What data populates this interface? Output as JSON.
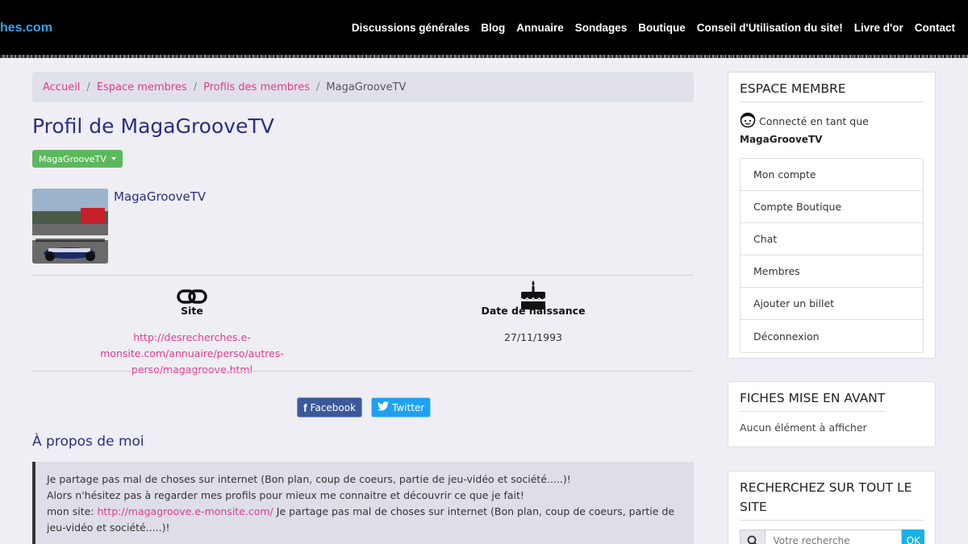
{
  "header": {
    "logo_text": "hes.com",
    "nav": [
      "Discussions générales",
      "Blog",
      "Annuaire",
      "Sondages",
      "Boutique",
      "Conseil d'Utilisation du site!",
      "Livre d'or",
      "Contact"
    ]
  },
  "breadcrumb": {
    "items": [
      "Accueil",
      "Espace membres",
      "Profils des membres"
    ],
    "current": "MagaGrooveTV"
  },
  "profile": {
    "title": "Profil de MagaGrooveTV",
    "dropdown_label": "MagaGrooveTV",
    "name": "MagaGrooveTV",
    "site_label": "Site",
    "site_url": "http://desrecherches.e-monsite.com/annuaire/perso/autres-perso/magagroove.html",
    "birth_label": "Date de naissance",
    "birth_date": "27/11/1993",
    "share_facebook": "Facebook",
    "share_twitter": "Twitter",
    "about_title": "À propos de moi",
    "about_line1": "Je partage pas mal de choses sur internet (Bon plan, coup de coeurs, partie de jeu-vidéo et société.....)!",
    "about_line2": "Alors n'hésitez pas à regarder mes profils pour mieux me connaitre et découvrir ce que je fait!",
    "about_prefix": "mon site: ",
    "about_link": "http://magagroove.e-monsite.com/",
    "about_suffix": " Je partage pas mal de choses sur internet (Bon plan, coup de coeurs, partie de jeu-vidéo et société.....)!"
  },
  "sidebar": {
    "member_title": "ESPACE MEMBRE",
    "connected_text": "Connecté en tant que",
    "username": "MagaGrooveTV",
    "menu": [
      "Mon compte",
      "Compte Boutique",
      "Chat",
      "Membres",
      "Ajouter un billet",
      "Déconnexion"
    ],
    "featured_title": "FICHES MISE EN AVANT",
    "featured_empty": "Aucun élément à afficher",
    "search_title": "RECHERCHEZ SUR TOUT LE SITE",
    "search_placeholder": "Votre recherche",
    "search_ok": "OK"
  },
  "colors": {
    "accent_pink": "#e03a8e",
    "title_blue": "#2b2e83",
    "green": "#5cb85c"
  }
}
